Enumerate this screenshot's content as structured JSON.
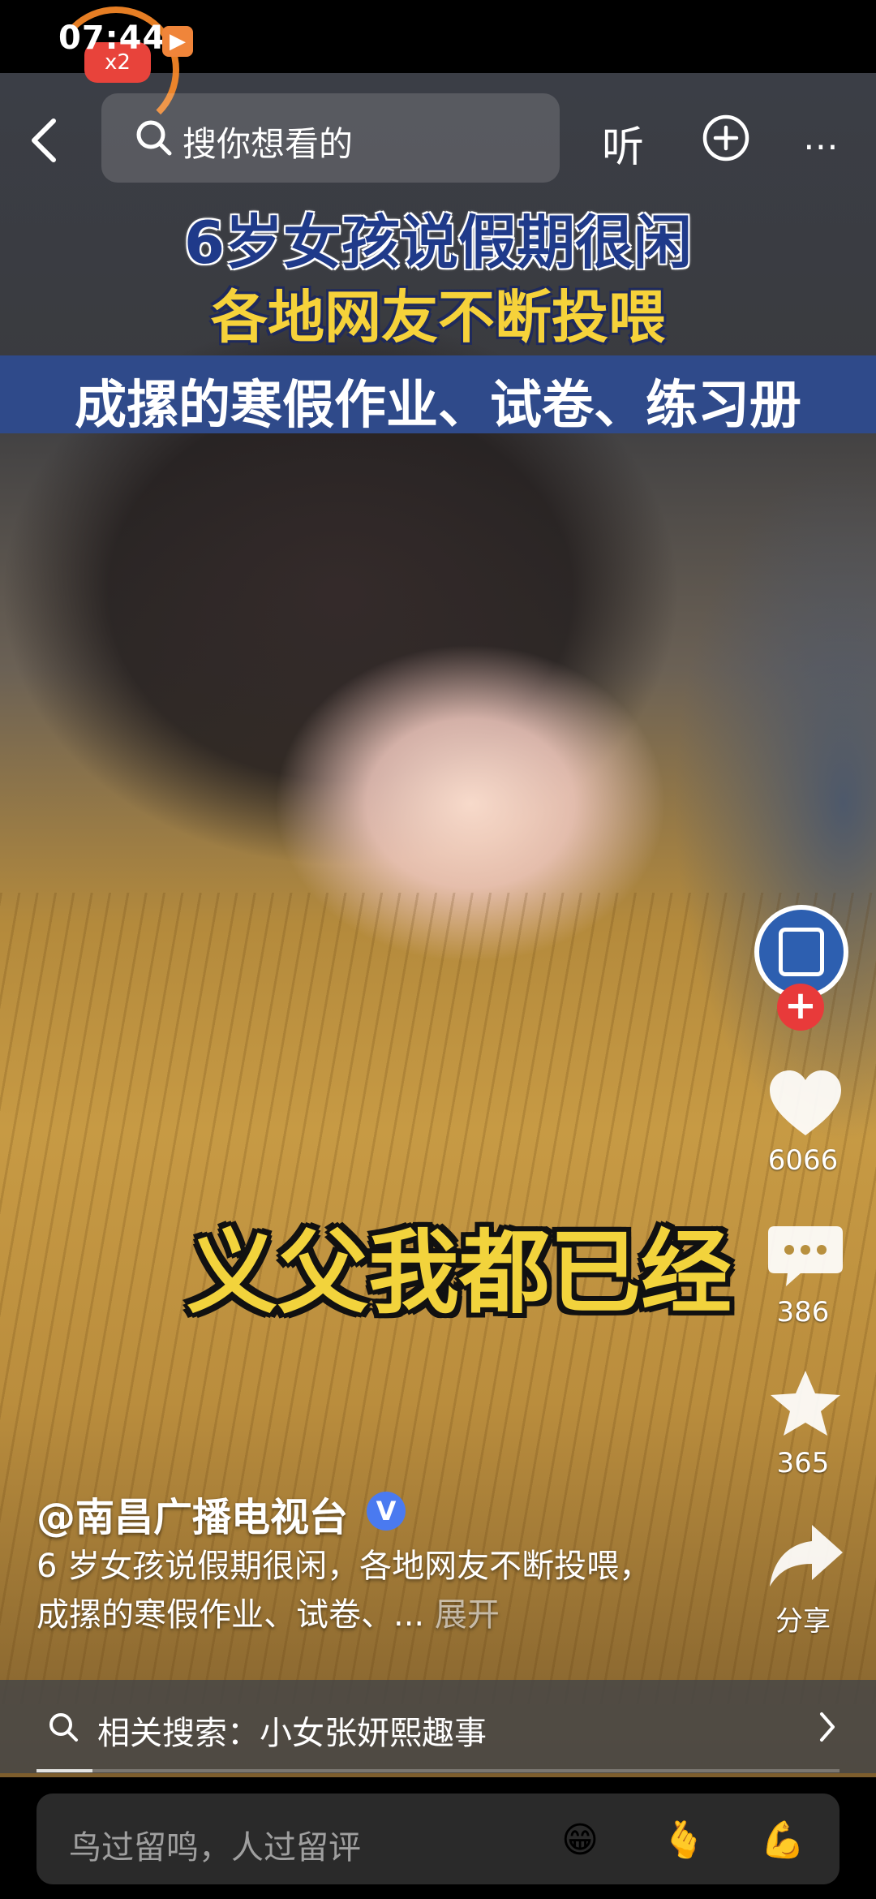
{
  "status": {
    "time": "07:44",
    "badge": "x2",
    "play_glyph": "▶"
  },
  "topbar": {
    "search_placeholder": "搜你想看的",
    "listen_label": "听",
    "more_glyph": "⋯"
  },
  "overlay": {
    "headline1": "6岁女孩说假期很闲",
    "headline2": "各地网友不断投喂",
    "headline3": "成摞的寒假作业、试卷、练习册",
    "subtitle": "义父我都已经"
  },
  "rail": {
    "follow_glyph": "+",
    "likes": "6066",
    "comments": "386",
    "favorites": "365",
    "share_label": "分享"
  },
  "caption": {
    "author": "@南昌广播电视台",
    "verified_glyph": "V",
    "description": "6 岁女孩说假期很闲，各地网友不断投喂，成摞的寒假作业、试卷、... ",
    "expand_label": "展开"
  },
  "related_search": {
    "label": "相关搜索：小女张妍熙趣事"
  },
  "playback": {
    "progress": 0.07
  },
  "comment_bar": {
    "placeholder": "鸟过留鸣，人过留评",
    "emojis": [
      "😁",
      "🫰",
      "💪"
    ]
  },
  "colors": {
    "headline_blue": "#1f3a8a",
    "headline_yellow": "#f6d23a",
    "band_blue": "#2f4a8a",
    "follow_red": "#e83a3a",
    "verified_blue": "#4a7af0"
  }
}
